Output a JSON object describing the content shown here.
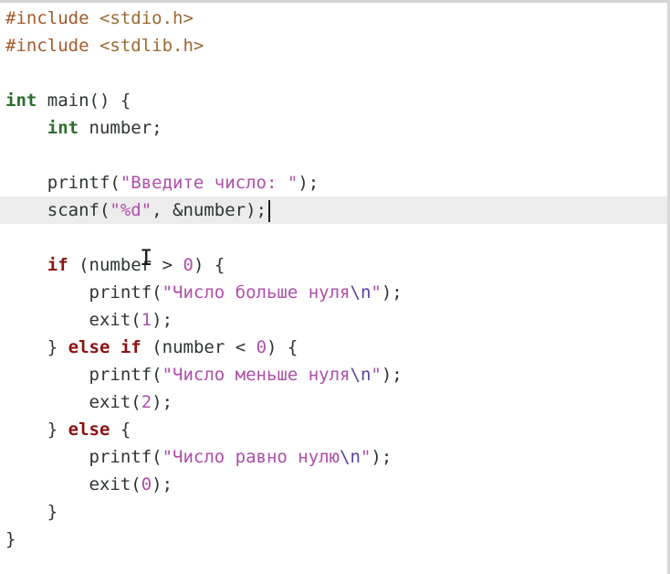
{
  "editor": {
    "lines": [
      [
        {
          "t": "#include ",
          "c": "pp"
        },
        {
          "t": "<stdio.h>",
          "c": "hdr"
        }
      ],
      [
        {
          "t": "#include ",
          "c": "pp"
        },
        {
          "t": "<stdlib.h>",
          "c": "hdr"
        }
      ],
      [],
      [
        {
          "t": "int",
          "c": "ty"
        },
        {
          "t": " main() {",
          "c": ""
        }
      ],
      [
        {
          "t": "    ",
          "c": ""
        },
        {
          "t": "int",
          "c": "ty"
        },
        {
          "t": " number;",
          "c": ""
        }
      ],
      [],
      [
        {
          "t": "    printf(",
          "c": ""
        },
        {
          "t": "\"Введите число: \"",
          "c": "str"
        },
        {
          "t": ");",
          "c": ""
        }
      ],
      [
        {
          "t": "    scanf(",
          "c": ""
        },
        {
          "t": "\"%d\"",
          "c": "str"
        },
        {
          "t": ", &number);",
          "c": ""
        }
      ],
      [],
      [
        {
          "t": "    ",
          "c": ""
        },
        {
          "t": "if",
          "c": "kw"
        },
        {
          "t": " (number > ",
          "c": ""
        },
        {
          "t": "0",
          "c": "num"
        },
        {
          "t": ") {",
          "c": ""
        }
      ],
      [
        {
          "t": "        printf(",
          "c": ""
        },
        {
          "t": "\"Число больше нуля",
          "c": "str"
        },
        {
          "t": "\\n",
          "c": "esc"
        },
        {
          "t": "\"",
          "c": "str"
        },
        {
          "t": ");",
          "c": ""
        }
      ],
      [
        {
          "t": "        exit(",
          "c": ""
        },
        {
          "t": "1",
          "c": "num"
        },
        {
          "t": ");",
          "c": ""
        }
      ],
      [
        {
          "t": "    } ",
          "c": ""
        },
        {
          "t": "else",
          "c": "kw"
        },
        {
          "t": " ",
          "c": ""
        },
        {
          "t": "if",
          "c": "kw"
        },
        {
          "t": " (number < ",
          "c": ""
        },
        {
          "t": "0",
          "c": "num"
        },
        {
          "t": ") {",
          "c": ""
        }
      ],
      [
        {
          "t": "        printf(",
          "c": ""
        },
        {
          "t": "\"Число меньше нуля",
          "c": "str"
        },
        {
          "t": "\\n",
          "c": "esc"
        },
        {
          "t": "\"",
          "c": "str"
        },
        {
          "t": ");",
          "c": ""
        }
      ],
      [
        {
          "t": "        exit(",
          "c": ""
        },
        {
          "t": "2",
          "c": "num"
        },
        {
          "t": ");",
          "c": ""
        }
      ],
      [
        {
          "t": "    } ",
          "c": ""
        },
        {
          "t": "else",
          "c": "kw"
        },
        {
          "t": " {",
          "c": ""
        }
      ],
      [
        {
          "t": "        printf(",
          "c": ""
        },
        {
          "t": "\"Число равно нулю",
          "c": "str"
        },
        {
          "t": "\\n",
          "c": "esc"
        },
        {
          "t": "\"",
          "c": "str"
        },
        {
          "t": ");",
          "c": ""
        }
      ],
      [
        {
          "t": "        exit(",
          "c": ""
        },
        {
          "t": "0",
          "c": "num"
        },
        {
          "t": ");",
          "c": ""
        }
      ],
      [
        {
          "t": "    }",
          "c": ""
        }
      ],
      [
        {
          "t": "}",
          "c": ""
        }
      ]
    ],
    "current_line_index": 7,
    "caret_icon": "text-caret",
    "mouse_cursor_icon": "i-beam-cursor",
    "colors": {
      "background": "#ffffff",
      "current_line": "#ececec",
      "keyword": "#8b1212",
      "type": "#2c6e2c",
      "string": "#ad4fa8",
      "preprocessor": "#a35a2a"
    }
  }
}
